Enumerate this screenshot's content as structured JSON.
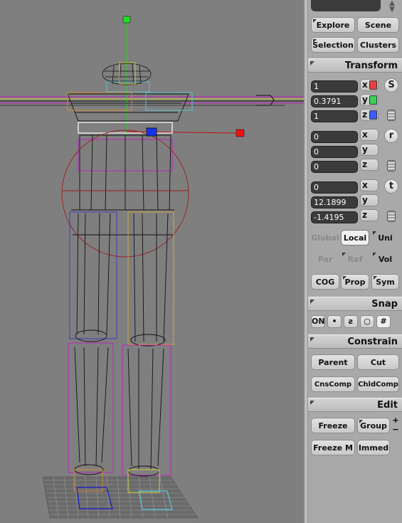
{
  "panel": {
    "tabs": {
      "explore": "Explore",
      "scene": "Scene",
      "selection": "Selection",
      "clusters": "Clusters"
    },
    "transform": {
      "title": "Transform",
      "scale": {
        "x": "1",
        "y": "0.3791",
        "z": "1"
      },
      "rotate": {
        "x": "0",
        "y": "0",
        "z": "0"
      },
      "translate": {
        "x": "0",
        "y": "12.1899",
        "z": "-1.4195"
      },
      "axis_labels": {
        "x": "x",
        "y": "y",
        "z": "z"
      },
      "mode_s": "S",
      "mode_r": "r",
      "mode_t": "t",
      "space": {
        "global": "Global",
        "local": "Local",
        "uni": "Uni"
      },
      "ref": {
        "par": "Par",
        "ref": "Ref",
        "vol": "Vol"
      },
      "cog": "COG",
      "prop": "Prop",
      "sym": "Sym"
    },
    "snap": {
      "title": "Snap",
      "on": "ON"
    },
    "constrain": {
      "title": "Constrain",
      "parent": "Parent",
      "cut": "Cut",
      "cnscomp": "CnsComp",
      "chldcomp": "ChldComp"
    },
    "edit": {
      "title": "Edit",
      "freeze": "Freeze",
      "group": "Group",
      "freeze_m": "Freeze M",
      "immed": "Immed",
      "plus": "+",
      "minus": "−"
    }
  },
  "colors": {
    "x_axis": "#e84040",
    "y_axis": "#3ecf5a",
    "z_axis": "#3b5cff",
    "viewport_bg": "#7f7f7f"
  }
}
